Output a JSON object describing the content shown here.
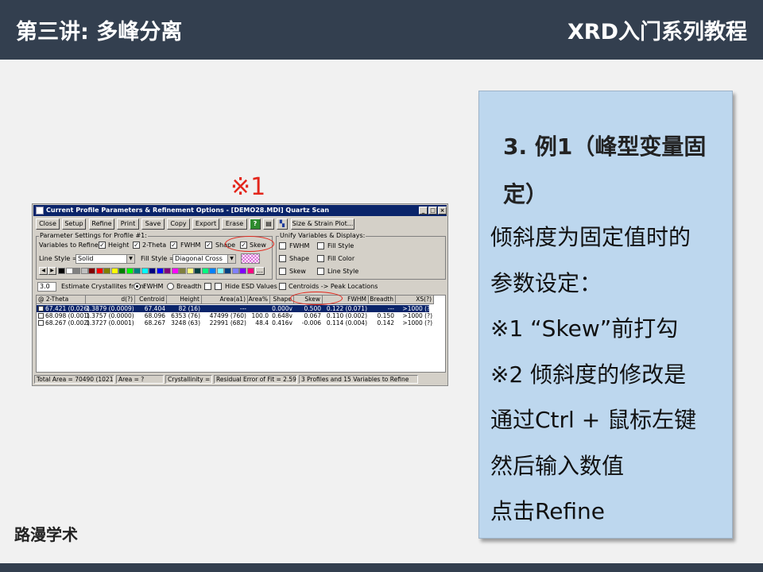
{
  "header": {
    "left_title": "第三讲: 多峰分离",
    "right_title": "XRD入门系列教程"
  },
  "footer": {
    "brand": "路漫学术"
  },
  "marks": {
    "m1": "※1",
    "m2": "※2"
  },
  "panel": {
    "heading_line1": "3. 例1（峰型变量固",
    "heading_line2": "定）",
    "lines": [
      "倾斜度为固定值时的",
      "参数设定：",
      "※1 “Skew”前打勾",
      "※2   倾斜度的修改是",
      "通过Ctrl + 鼠标左键",
      "然后输入数值",
      "点击Refine"
    ]
  },
  "window": {
    "title": "Current Profile Parameters & Refinement Options - [DEMO28.MDI] Quartz Scan",
    "controls": [
      "_",
      "□",
      "×"
    ],
    "toolbar": [
      "Close",
      "Setup",
      "Refine",
      "Print",
      "Save",
      "Copy",
      "Export",
      "Erase",
      "Size & Strain Plot..."
    ],
    "param_group": {
      "title": "Parameter Settings for Profile #1:",
      "refine_label": "Variables to Refine:",
      "vars": [
        {
          "label": "Height",
          "checked": true
        },
        {
          "label": "2-Theta",
          "checked": true
        },
        {
          "label": "FWHM",
          "checked": true
        },
        {
          "label": "Shape",
          "checked": true
        },
        {
          "label": "Skew",
          "checked": true
        }
      ],
      "line_style_label": "Line Style =",
      "line_style_value": "Solid",
      "fill_style_label": "Fill Style =",
      "fill_style_value": "Diagonal Cross",
      "swatch_colors": [
        "#000000",
        "#ffffff",
        "#808080",
        "#c0c0c0",
        "#800000",
        "#ff0000",
        "#808000",
        "#ffff00",
        "#008000",
        "#00ff00",
        "#008080",
        "#00ffff",
        "#000080",
        "#0000ff",
        "#800080",
        "#ff00ff",
        "#808040",
        "#ffff80",
        "#004040",
        "#00ff80",
        "#0080ff",
        "#80ffff",
        "#004080",
        "#8080ff",
        "#8000ff",
        "#ff0080"
      ]
    },
    "unify_group": {
      "title": "Unify Variables & Displays:",
      "items": [
        "FWHM",
        "Fill Style",
        "Shape",
        "Fill Color",
        "Skew",
        "Line Style"
      ]
    },
    "estimate": {
      "value": "3.0",
      "label": "Estimate Crystallites from:",
      "radio1": "FWHM",
      "radio2": "Breadth",
      "hide_esd": "Hide ESD Values",
      "centroids": "Centroids -> Peak Locations"
    },
    "grid": {
      "headers": [
        "@ 2-Theta",
        "d(?)",
        "Centroid",
        "Height",
        "Area(a1)",
        "Area%",
        "Shape",
        "Skew",
        "FWHM",
        "Breadth",
        "XS(?)"
      ],
      "rows": [
        [
          "67.421 (0.026)",
          "1.3879 (0.0009)",
          "67.404",
          "82 (16)",
          "---",
          "",
          "0.000v",
          "0.500",
          "0.122 (0.071)",
          "---",
          ">1000 (?)"
        ],
        [
          "68.098 (0.001)",
          "1.3757 (0.0000)",
          "68.096",
          "6353 (76)",
          "47499 (760)",
          "100.0",
          "0.648v",
          "0.067",
          "0.110 (0.002)",
          "0.150",
          ">1000 (?)"
        ],
        [
          "68.267 (0.002)",
          "1.3727 (0.0001)",
          "68.267",
          "3248 (63)",
          "22991 (682)",
          "48.4",
          "0.416v",
          "-0.006",
          "0.114 (0.004)",
          "0.142",
          ">1000 (?)"
        ]
      ]
    },
    "status": [
      "Total Area = 70490 (1021)",
      "Area = ?",
      "Crystallinity = ?",
      "Residual Error of Fit = 2.59%",
      "3 Profiles and 15 Variables to Refine"
    ]
  },
  "colors": {
    "header_bg": "#333f4f",
    "panel_bg": "#bdd7ee",
    "mark_red": "#e3261b",
    "selection": "#0a246a"
  }
}
